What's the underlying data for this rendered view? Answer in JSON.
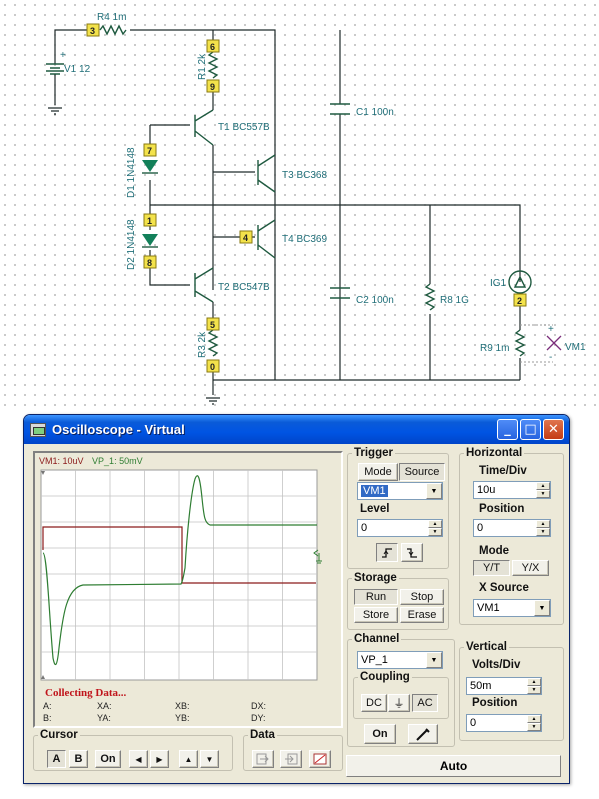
{
  "schematic": {
    "components": [
      {
        "id": "R4",
        "label": "R4 1m"
      },
      {
        "id": "V1",
        "label": "V1 12",
        "polarity": "+"
      },
      {
        "id": "R1",
        "label": "R1 2k"
      },
      {
        "id": "C1",
        "label": "C1 100n"
      },
      {
        "id": "T1",
        "label": "T1 BC557B"
      },
      {
        "id": "D1",
        "label": "D1 1N4148"
      },
      {
        "id": "T3",
        "label": "T3 BC368"
      },
      {
        "id": "T4",
        "label": "T4 BC369"
      },
      {
        "id": "D2",
        "label": "D2 1N4148"
      },
      {
        "id": "T2",
        "label": "T2 BC547B"
      },
      {
        "id": "C2",
        "label": "C2 100n"
      },
      {
        "id": "R8",
        "label": "R8 1G"
      },
      {
        "id": "IG1",
        "label": "IG1"
      },
      {
        "id": "R9",
        "label": "R9 1m"
      },
      {
        "id": "R3",
        "label": "R3 2k"
      },
      {
        "id": "VM1",
        "label": "VM1",
        "plus": "+",
        "minus": "-"
      }
    ],
    "nodes": [
      "3",
      "6",
      "9",
      "7",
      "1",
      "8",
      "4",
      "5",
      "0",
      "2"
    ]
  },
  "window": {
    "title": "Oscilloscope - Virtual",
    "buttons": {
      "minimize": "_",
      "maximize": "□",
      "close": "✕"
    }
  },
  "scope": {
    "channel_a_label": "VM1: 10uV",
    "channel_b_label": "VP_1: 50mV",
    "status": "Collecting Data...",
    "readouts": {
      "A": "A:",
      "B": "B:",
      "XA": "XA:",
      "YA": "YA:",
      "XB": "XB:",
      "YB": "YB:",
      "DX": "DX:",
      "DY": "DY:"
    },
    "colors": {
      "ch_a": "#8b1a1a",
      "ch_b": "#2e7d32",
      "grid": "#b8b8b8"
    }
  },
  "cursor": {
    "legend": "Cursor",
    "buttons": [
      "A",
      "B",
      "On"
    ],
    "arrows": [
      "◀",
      "▶",
      "▲",
      "▼"
    ]
  },
  "data_group": {
    "legend": "Data"
  },
  "trigger": {
    "legend": "Trigger",
    "mode_label": "Mode",
    "source_label": "Source",
    "source_value": "VM1",
    "level_label": "Level",
    "level_value": "0",
    "edge_rising": "↗",
    "edge_falling": "↘"
  },
  "storage": {
    "legend": "Storage",
    "run": "Run",
    "stop": "Stop",
    "store": "Store",
    "erase": "Erase"
  },
  "channel": {
    "legend": "Channel",
    "value": "VP_1",
    "coupling_legend": "Coupling",
    "dc": "DC",
    "gnd": "⏚",
    "ac": "AC",
    "on": "On"
  },
  "horizontal": {
    "legend": "Horizontal",
    "time_div_label": "Time/Div",
    "time_div_value": "10u",
    "position_label": "Position",
    "position_value": "0",
    "mode_label": "Mode",
    "yt": "Y/T",
    "yx": "Y/X",
    "xsource_label": "X Source",
    "xsource_value": "VM1"
  },
  "vertical": {
    "legend": "Vertical",
    "volts_div_label": "Volts/Div",
    "volts_div_value": "50m",
    "position_label": "Position",
    "position_value": "0"
  },
  "auto_button": "Auto"
}
